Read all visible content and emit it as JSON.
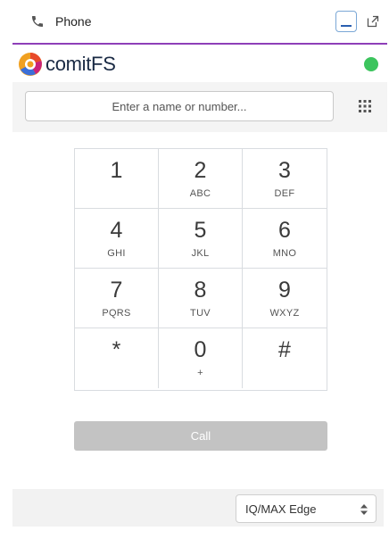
{
  "header": {
    "title": "Phone",
    "phone_icon": "phone-icon",
    "minimize_icon": "minimize-icon",
    "popout_icon": "popout-icon",
    "accent_color": "#8e3fb8"
  },
  "brand": {
    "name": "comitFS",
    "status": "online",
    "status_color": "#3cc45d"
  },
  "search": {
    "placeholder": "Enter a name or number...",
    "value": ""
  },
  "dialpad_icon": "grid-icon",
  "keypad": [
    {
      "digit": "1",
      "letters": ""
    },
    {
      "digit": "2",
      "letters": "ABC"
    },
    {
      "digit": "3",
      "letters": "DEF"
    },
    {
      "digit": "4",
      "letters": "GHI"
    },
    {
      "digit": "5",
      "letters": "JKL"
    },
    {
      "digit": "6",
      "letters": "MNO"
    },
    {
      "digit": "7",
      "letters": "PQRS"
    },
    {
      "digit": "8",
      "letters": "TUV"
    },
    {
      "digit": "9",
      "letters": "WXYZ"
    },
    {
      "digit": "*",
      "letters": ""
    },
    {
      "digit": "0",
      "letters": "+"
    },
    {
      "digit": "#",
      "letters": ""
    }
  ],
  "call_button": {
    "label": "Call",
    "enabled": false
  },
  "footer": {
    "selected_option": "IQ/MAX Edge"
  }
}
